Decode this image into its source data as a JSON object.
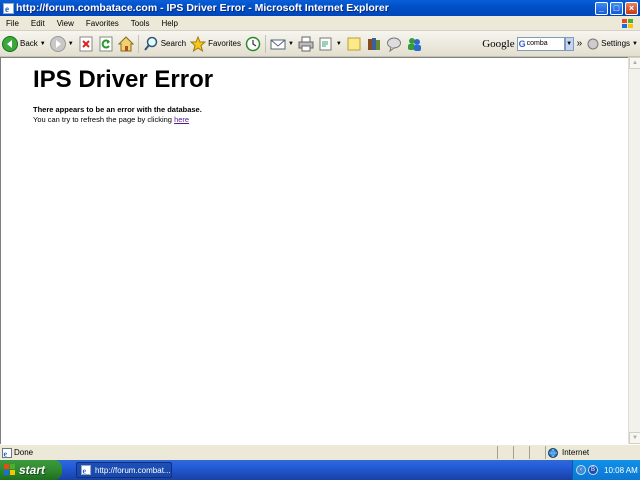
{
  "window": {
    "title": "http://forum.combatace.com - IPS Driver Error - Microsoft Internet Explorer",
    "minimize": "_",
    "maximize": "□",
    "close": "×"
  },
  "menu": [
    "File",
    "Edit",
    "View",
    "Favorites",
    "Tools",
    "Help"
  ],
  "toolbar": {
    "back_label": "Back",
    "search_label": "Search",
    "favorites_label": "Favorites",
    "google_label": "Google",
    "google_query": "comba",
    "google_g": "G",
    "chevron": "»",
    "settings_label": "Settings"
  },
  "page": {
    "heading": "IPS Driver Error",
    "line1": "There appears to be an error with the database.",
    "line2": "You can try to refresh the page by clicking",
    "link": "here"
  },
  "status": {
    "text": "Done",
    "zone": "Internet"
  },
  "taskbar": {
    "start": "start",
    "task": "http://forum.combat...",
    "time": "10:08 AM"
  }
}
